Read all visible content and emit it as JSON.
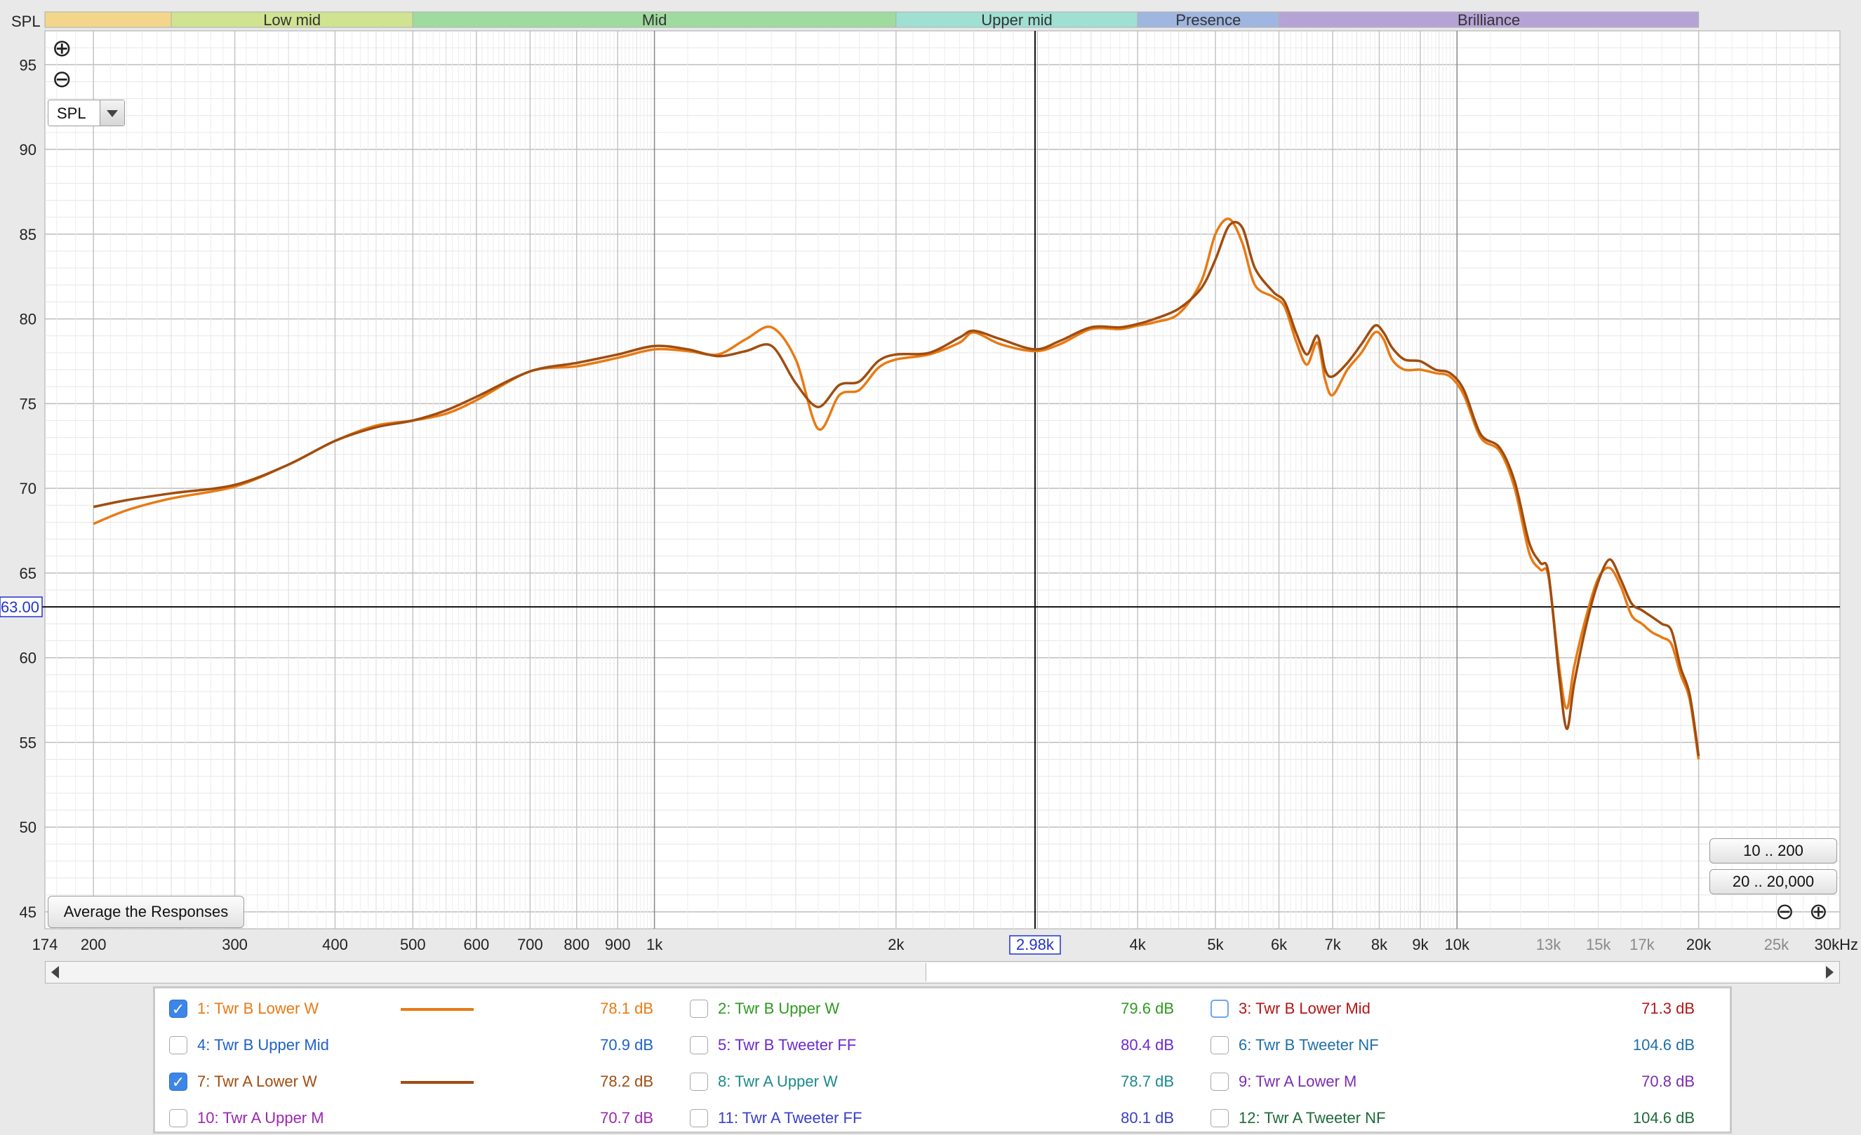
{
  "app": {
    "zoom_in_icon": "magnifier-plus-icon",
    "zoom_out_icon": "magnifier-minus-icon",
    "measurement_select_value": "SPL",
    "average_button_label": "Average the Responses",
    "range_button_1": "10 .. 200",
    "range_button_2": "20 .. 20,000"
  },
  "bands": [
    {
      "label": "",
      "from": 174,
      "to": 250,
      "color": "#f3d68c"
    },
    {
      "label": "Low mid",
      "from": 250,
      "to": 500,
      "color": "#cfe391"
    },
    {
      "label": "Mid",
      "from": 500,
      "to": 2000,
      "color": "#9fdb9e"
    },
    {
      "label": "Upper mid",
      "from": 2000,
      "to": 4000,
      "color": "#9fe0d3"
    },
    {
      "label": "Presence",
      "from": 4000,
      "to": 6000,
      "color": "#9fb6e0"
    },
    {
      "label": "Brilliance",
      "from": 6000,
      "to": 20000,
      "color": "#b6a3d6"
    }
  ],
  "chart_data": {
    "type": "line",
    "ylabel": "SPL",
    "xlabel_unit": "kHz",
    "xlim": [
      174,
      30000
    ],
    "ylim": [
      44,
      97
    ],
    "x_scale": "log",
    "yticks": [
      45,
      50,
      55,
      60,
      65,
      70,
      75,
      80,
      85,
      90,
      95
    ],
    "xticks_major": [
      {
        "v": 174,
        "label": "174"
      },
      {
        "v": 200,
        "label": "200"
      },
      {
        "v": 300,
        "label": "300"
      },
      {
        "v": 400,
        "label": "400"
      },
      {
        "v": 500,
        "label": "500"
      },
      {
        "v": 600,
        "label": "600"
      },
      {
        "v": 700,
        "label": "700"
      },
      {
        "v": 800,
        "label": "800"
      },
      {
        "v": 900,
        "label": "900"
      },
      {
        "v": 1000,
        "label": "1k"
      },
      {
        "v": 2000,
        "label": "2k"
      },
      {
        "v": 4000,
        "label": "4k"
      },
      {
        "v": 5000,
        "label": "5k"
      },
      {
        "v": 6000,
        "label": "6k"
      },
      {
        "v": 7000,
        "label": "7k"
      },
      {
        "v": 8000,
        "label": "8k"
      },
      {
        "v": 9000,
        "label": "9k"
      },
      {
        "v": 10000,
        "label": "10k"
      },
      {
        "v": 20000,
        "label": "20k"
      }
    ],
    "xticks_minor_labeled": [
      {
        "v": 13000,
        "label": "13k"
      },
      {
        "v": 15000,
        "label": "15k"
      },
      {
        "v": 17000,
        "label": "17k"
      },
      {
        "v": 25000,
        "label": "25k"
      },
      {
        "v": 30000,
        "label": "30kHz"
      }
    ],
    "cursor": {
      "x": 2980,
      "x_label": "2.98k",
      "y": 63.0,
      "y_label": "63.00"
    },
    "grid": true,
    "series": [
      {
        "name": "1: Twr B Lower W",
        "color": "#e87a14",
        "points": [
          [
            200,
            67.9
          ],
          [
            220,
            68.7
          ],
          [
            250,
            69.4
          ],
          [
            300,
            70.1
          ],
          [
            350,
            71.4
          ],
          [
            400,
            72.8
          ],
          [
            450,
            73.7
          ],
          [
            500,
            74.0
          ],
          [
            550,
            74.4
          ],
          [
            600,
            75.2
          ],
          [
            700,
            76.9
          ],
          [
            800,
            77.2
          ],
          [
            900,
            77.7
          ],
          [
            1000,
            78.2
          ],
          [
            1100,
            78.1
          ],
          [
            1200,
            77.9
          ],
          [
            1300,
            78.8
          ],
          [
            1400,
            79.5
          ],
          [
            1500,
            77.6
          ],
          [
            1600,
            73.5
          ],
          [
            1700,
            75.5
          ],
          [
            1800,
            75.8
          ],
          [
            1900,
            77.1
          ],
          [
            2000,
            77.6
          ],
          [
            2200,
            77.9
          ],
          [
            2400,
            78.6
          ],
          [
            2500,
            79.2
          ],
          [
            2700,
            78.5
          ],
          [
            2980,
            78.1
          ],
          [
            3200,
            78.5
          ],
          [
            3500,
            79.4
          ],
          [
            3800,
            79.4
          ],
          [
            4000,
            79.6
          ],
          [
            4200,
            79.8
          ],
          [
            4500,
            80.3
          ],
          [
            4800,
            82.2
          ],
          [
            5000,
            85.0
          ],
          [
            5200,
            85.9
          ],
          [
            5400,
            84.5
          ],
          [
            5600,
            82.0
          ],
          [
            5900,
            81.3
          ],
          [
            6100,
            80.7
          ],
          [
            6300,
            78.7
          ],
          [
            6500,
            77.3
          ],
          [
            6700,
            78.6
          ],
          [
            6850,
            76.4
          ],
          [
            7000,
            75.5
          ],
          [
            7300,
            77.0
          ],
          [
            7600,
            78.0
          ],
          [
            7900,
            79.2
          ],
          [
            8100,
            78.8
          ],
          [
            8300,
            77.6
          ],
          [
            8600,
            77.0
          ],
          [
            9000,
            77.0
          ],
          [
            9400,
            76.8
          ],
          [
            9800,
            76.6
          ],
          [
            10200,
            75.5
          ],
          [
            10700,
            73.0
          ],
          [
            11300,
            72.2
          ],
          [
            11800,
            70.0
          ],
          [
            12300,
            66.2
          ],
          [
            12700,
            65.2
          ],
          [
            13000,
            64.8
          ],
          [
            13400,
            59.5
          ],
          [
            13700,
            57.0
          ],
          [
            14000,
            59.5
          ],
          [
            14500,
            62.5
          ],
          [
            15000,
            64.7
          ],
          [
            15500,
            65.3
          ],
          [
            16000,
            64.2
          ],
          [
            16500,
            62.5
          ],
          [
            17000,
            62.0
          ],
          [
            17500,
            61.5
          ],
          [
            18000,
            61.2
          ],
          [
            18500,
            60.8
          ],
          [
            19000,
            59.0
          ],
          [
            19500,
            57.5
          ],
          [
            20000,
            54.0
          ]
        ]
      },
      {
        "name": "7: Twr A Lower W",
        "color": "#a04d10",
        "points": [
          [
            200,
            68.9
          ],
          [
            220,
            69.3
          ],
          [
            250,
            69.7
          ],
          [
            300,
            70.2
          ],
          [
            350,
            71.4
          ],
          [
            400,
            72.8
          ],
          [
            450,
            73.6
          ],
          [
            500,
            74.0
          ],
          [
            550,
            74.6
          ],
          [
            600,
            75.4
          ],
          [
            700,
            76.9
          ],
          [
            800,
            77.4
          ],
          [
            900,
            77.9
          ],
          [
            1000,
            78.4
          ],
          [
            1100,
            78.2
          ],
          [
            1200,
            77.8
          ],
          [
            1300,
            78.1
          ],
          [
            1400,
            78.4
          ],
          [
            1500,
            76.2
          ],
          [
            1600,
            74.8
          ],
          [
            1700,
            76.1
          ],
          [
            1800,
            76.3
          ],
          [
            1900,
            77.5
          ],
          [
            2000,
            77.9
          ],
          [
            2200,
            78.0
          ],
          [
            2400,
            78.9
          ],
          [
            2500,
            79.3
          ],
          [
            2700,
            78.8
          ],
          [
            2980,
            78.2
          ],
          [
            3200,
            78.7
          ],
          [
            3500,
            79.5
          ],
          [
            3800,
            79.5
          ],
          [
            4000,
            79.7
          ],
          [
            4200,
            80.0
          ],
          [
            4500,
            80.6
          ],
          [
            4800,
            81.8
          ],
          [
            5000,
            83.5
          ],
          [
            5200,
            85.5
          ],
          [
            5400,
            85.4
          ],
          [
            5600,
            83.0
          ],
          [
            5900,
            81.6
          ],
          [
            6100,
            81.0
          ],
          [
            6300,
            79.2
          ],
          [
            6500,
            77.9
          ],
          [
            6700,
            79.0
          ],
          [
            6850,
            77.0
          ],
          [
            7000,
            76.6
          ],
          [
            7300,
            77.4
          ],
          [
            7600,
            78.5
          ],
          [
            7900,
            79.6
          ],
          [
            8100,
            79.2
          ],
          [
            8300,
            78.3
          ],
          [
            8600,
            77.6
          ],
          [
            9000,
            77.5
          ],
          [
            9400,
            77.0
          ],
          [
            9800,
            76.8
          ],
          [
            10200,
            75.8
          ],
          [
            10700,
            73.2
          ],
          [
            11300,
            72.4
          ],
          [
            11800,
            70.4
          ],
          [
            12300,
            66.8
          ],
          [
            12700,
            65.6
          ],
          [
            13000,
            65.0
          ],
          [
            13400,
            59.0
          ],
          [
            13700,
            55.8
          ],
          [
            14000,
            58.5
          ],
          [
            14500,
            62.0
          ],
          [
            15000,
            64.5
          ],
          [
            15500,
            65.8
          ],
          [
            16000,
            64.6
          ],
          [
            16500,
            63.2
          ],
          [
            17000,
            62.8
          ],
          [
            17500,
            62.4
          ],
          [
            18000,
            62.0
          ],
          [
            18500,
            61.6
          ],
          [
            19000,
            59.4
          ],
          [
            19500,
            57.8
          ],
          [
            20000,
            54.2
          ]
        ]
      }
    ]
  },
  "legend": [
    {
      "name": "1: Twr B Lower W",
      "value": "78.1 dB",
      "color": "#e87a14",
      "checked": true,
      "line": true
    },
    {
      "name": "2: Twr B Upper W",
      "value": "79.6 dB",
      "color": "#2e9a1f",
      "checked": false,
      "line": false
    },
    {
      "name": "3: Twr B Lower Mid",
      "value": "71.3 dB",
      "color": "#b51515",
      "checked": false,
      "line": false,
      "focus": true
    },
    {
      "name": "4: Twr B Upper Mid",
      "value": "70.9 dB",
      "color": "#1d61c8",
      "checked": false,
      "line": false
    },
    {
      "name": "5: Twr B Tweeter FF",
      "value": "80.4 dB",
      "color": "#6a2ad0",
      "checked": false,
      "line": false
    },
    {
      "name": "6: Twr B Tweeter NF",
      "value": "104.6 dB",
      "color": "#1f6fa8",
      "checked": false,
      "line": false
    },
    {
      "name": "7: Twr A Lower W",
      "value": "78.2 dB",
      "color": "#a04d10",
      "checked": true,
      "line": true
    },
    {
      "name": "8: Twr A Upper W",
      "value": "78.7 dB",
      "color": "#1b8a8a",
      "checked": false,
      "line": false
    },
    {
      "name": "9: Twr A Lower M",
      "value": "70.8 dB",
      "color": "#7a2db0",
      "checked": false,
      "line": false
    },
    {
      "name": "10: Twr A Upper M",
      "value": "70.7 dB",
      "color": "#9b27b0",
      "checked": false,
      "line": false
    },
    {
      "name": "11: Twr A Tweeter FF",
      "value": "80.1 dB",
      "color": "#3940c6",
      "checked": false,
      "line": false
    },
    {
      "name": "12: Twr A Tweeter NF",
      "value": "104.6 dB",
      "color": "#1e6a3a",
      "checked": false,
      "line": false
    }
  ]
}
